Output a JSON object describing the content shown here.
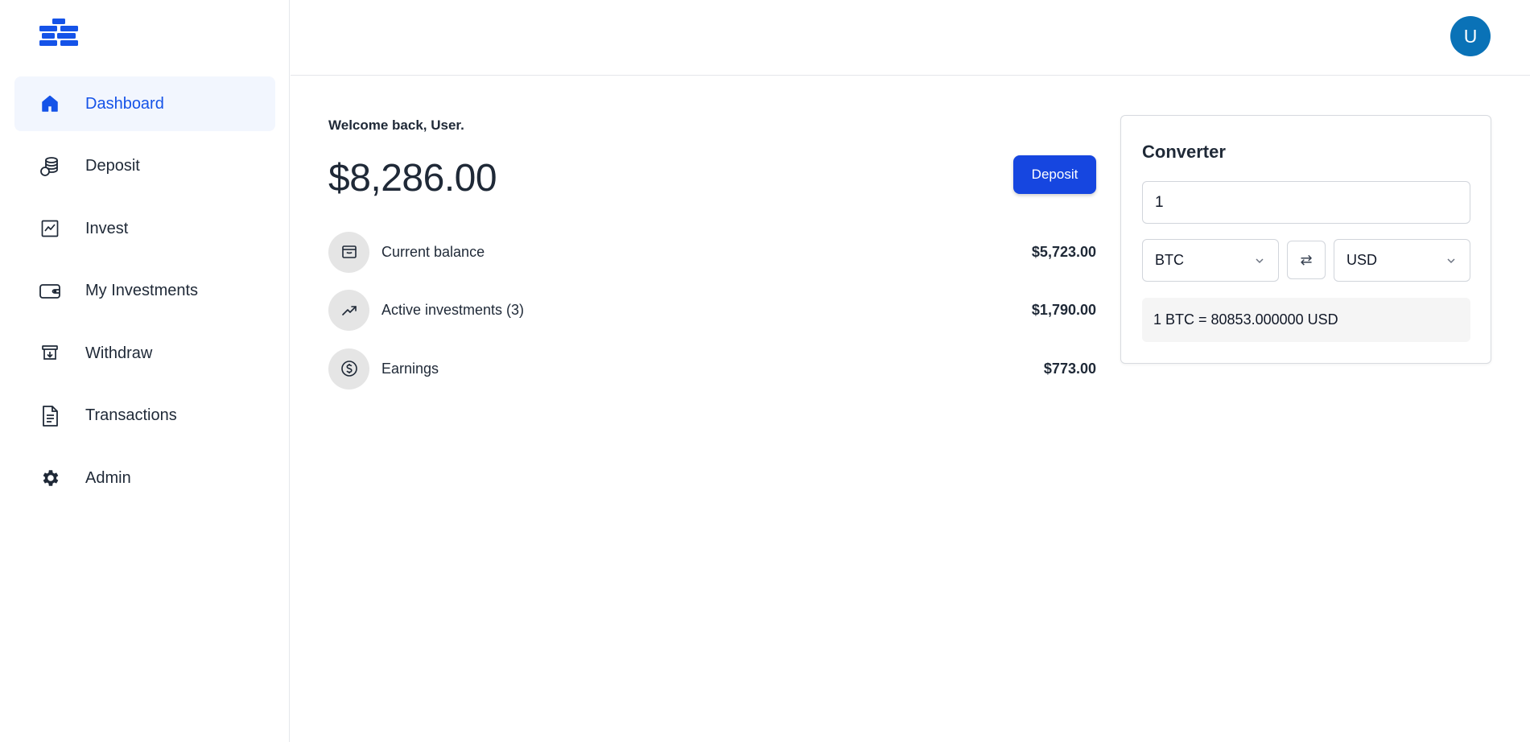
{
  "sidebar": {
    "items": [
      {
        "label": "Dashboard",
        "icon": "home-icon",
        "active": true
      },
      {
        "label": "Deposit",
        "icon": "coins-icon"
      },
      {
        "label": "Invest",
        "icon": "chart-line-icon"
      },
      {
        "label": "My Investments",
        "icon": "wallet-icon"
      },
      {
        "label": "Withdraw",
        "icon": "withdraw-icon"
      },
      {
        "label": "Transactions",
        "icon": "document-icon"
      },
      {
        "label": "Admin",
        "icon": "gear-icon"
      }
    ]
  },
  "header": {
    "avatar_initial": "U"
  },
  "main": {
    "welcome": "Welcome back, User.",
    "total_balance": "$8,286.00",
    "deposit_button": "Deposit",
    "stats": [
      {
        "label": "Current balance",
        "value": "$5,723.00",
        "icon": "archive-icon"
      },
      {
        "label": "Active investments (3)",
        "value": "$1,790.00",
        "icon": "trending-up-icon"
      },
      {
        "label": "Earnings",
        "value": "$773.00",
        "icon": "dollar-circle-icon"
      }
    ]
  },
  "converter": {
    "title": "Converter",
    "amount": "1",
    "from_currency": "BTC",
    "to_currency": "USD",
    "swap_symbol": "⇄",
    "result": "1 BTC = 80853.000000 USD"
  },
  "colors": {
    "accent": "#1553e8",
    "button": "#1646e0",
    "avatar": "#0a72b7",
    "active_bg": "#f2f6fe"
  }
}
